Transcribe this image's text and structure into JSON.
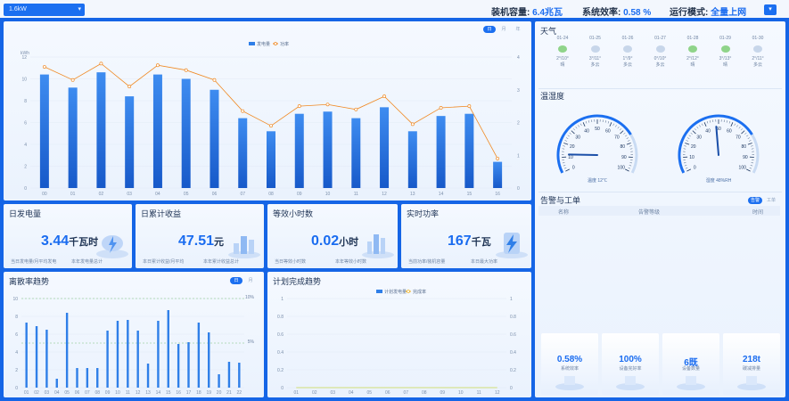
{
  "header": {
    "station": "1.6kW",
    "capacity_label": "装机容量:",
    "capacity_value": "6.4兆瓦",
    "efficiency_label": "系统效率:",
    "efficiency_value": "0.58 %",
    "mode_label": "运行模式:",
    "mode_value": "全量上网"
  },
  "main_chart": {
    "unit_label": "kWh",
    "legend": [
      "发电量",
      "功率"
    ],
    "range_tabs": [
      "日",
      "月",
      "年"
    ],
    "chart_data": {
      "type": "bar",
      "categories": [
        "00",
        "01",
        "02",
        "03",
        "04",
        "05",
        "06",
        "07",
        "08",
        "09",
        "10",
        "11",
        "12",
        "13",
        "14",
        "15",
        "16"
      ],
      "series": [
        {
          "name": "发电量",
          "type": "bar",
          "axis": "left",
          "values": [
            10.4,
            9.2,
            10.6,
            8.4,
            10.4,
            10.0,
            9.0,
            6.4,
            5.2,
            6.8,
            7.0,
            6.4,
            7.4,
            5.2,
            6.6,
            6.8,
            2.4
          ]
        },
        {
          "name": "功率",
          "type": "line",
          "axis": "right",
          "values": [
            3.7,
            3.3,
            3.8,
            3.1,
            3.75,
            3.6,
            3.3,
            2.35,
            1.9,
            2.5,
            2.55,
            2.4,
            2.8,
            1.95,
            2.45,
            2.5,
            0.9
          ]
        }
      ],
      "ylim": [
        0,
        12
      ],
      "y2lim": [
        0,
        4
      ],
      "yticks": [
        "0",
        "2",
        "4",
        "6",
        "8",
        "10",
        "12"
      ],
      "y2ticks": [
        "0",
        "1",
        "2",
        "3",
        "4"
      ]
    }
  },
  "stats": [
    {
      "title": "日发电量",
      "value": "3.44",
      "unit": "千瓦时",
      "foot_left": "当日发电量/月平均发电",
      "foot_right": "本年发电量总计"
    },
    {
      "title": "日累计收益",
      "value": "47.51",
      "unit": "元",
      "foot_left": "本日累计收益/月平均",
      "foot_right": "本年累计收益总计"
    },
    {
      "title": "等效小时数",
      "value": "0.02",
      "unit": "小时",
      "foot_left": "当日等效小时数",
      "foot_right": "本年等效小时数"
    },
    {
      "title": "实时功率",
      "value": "167",
      "unit": "千瓦",
      "foot_left": "当前功率/装机容量",
      "foot_right": "本日最大功率"
    }
  ],
  "pr_chart": {
    "title": "离散率趋势",
    "tabs": [
      "日",
      "月"
    ],
    "right_labels": [
      "10%",
      "5%"
    ],
    "chart_data": {
      "type": "bar",
      "categories": [
        "01",
        "02",
        "03",
        "04",
        "05",
        "06",
        "07",
        "08",
        "09",
        "10",
        "11",
        "12",
        "13",
        "14",
        "15",
        "16",
        "17",
        "18",
        "19",
        "20",
        "21",
        "22"
      ],
      "values": [
        7.3,
        6.9,
        6.5,
        1.0,
        8.4,
        2.2,
        2.2,
        2.2,
        6.4,
        7.5,
        7.6,
        6.4,
        2.7,
        7.5,
        8.7,
        4.9,
        5.1,
        7.3,
        6.2,
        1.5,
        2.9,
        2.8
      ],
      "ylim": [
        0,
        10
      ],
      "yticks": [
        "0",
        "2",
        "4",
        "6",
        "8",
        "10"
      ]
    }
  },
  "plan_chart": {
    "title": "计划完成趋势",
    "legend": [
      "计划发电量",
      "完成率"
    ],
    "chart_data": {
      "type": "bar",
      "categories": [
        "01",
        "02",
        "03",
        "04",
        "05",
        "06",
        "07",
        "08",
        "09",
        "10",
        "11",
        "12"
      ],
      "values": [
        0,
        0,
        0,
        0,
        0,
        0,
        0,
        0,
        0,
        0,
        0,
        0
      ],
      "ylim": [
        0,
        1
      ],
      "yticks": [
        "0",
        "0.2",
        "0.4",
        "0.6",
        "0.8",
        "1"
      ]
    }
  },
  "weather": {
    "title": "天气",
    "days": [
      {
        "date": "01-24",
        "temp": "2°/10°",
        "desc": "晴"
      },
      {
        "date": "01-25",
        "temp": "3°/11°",
        "desc": "多云"
      },
      {
        "date": "01-26",
        "temp": "1°/9°",
        "desc": "多云"
      },
      {
        "date": "01-27",
        "temp": "0°/10°",
        "desc": "多云"
      },
      {
        "date": "01-28",
        "temp": "2°/12°",
        "desc": "晴"
      },
      {
        "date": "01-29",
        "temp": "3°/13°",
        "desc": "晴"
      },
      {
        "date": "01-30",
        "temp": "2°/11°",
        "desc": "多云"
      }
    ]
  },
  "gauges": {
    "title": "温湿度",
    "items": [
      {
        "label": "温度 12℃",
        "value": 12,
        "max": 100,
        "ticks": [
          "0",
          "10",
          "20",
          "30",
          "40",
          "50",
          "60",
          "70",
          "80",
          "90",
          "100"
        ]
      },
      {
        "label": "湿度 48%RH",
        "value": 48,
        "max": 100,
        "ticks": [
          "0",
          "10",
          "20",
          "30",
          "40",
          "50",
          "60",
          "70",
          "80",
          "90",
          "100"
        ]
      }
    ]
  },
  "alarms": {
    "title": "告警与工单",
    "tabs": [
      "告警",
      "工单"
    ],
    "columns": [
      "名称",
      "告警等级",
      "时间"
    ],
    "cards": [
      {
        "value": "0.58%",
        "label": "系统效率"
      },
      {
        "value": "100%",
        "label": "设备完好率"
      },
      {
        "value": "6既",
        "label": "设备数量"
      },
      {
        "value": "218t",
        "label": "碳减排量"
      }
    ]
  },
  "colors": {
    "accent": "#1a6cf0",
    "bar": "#2f7fe8",
    "line": "#f08a24",
    "frame": "#1565e6"
  }
}
